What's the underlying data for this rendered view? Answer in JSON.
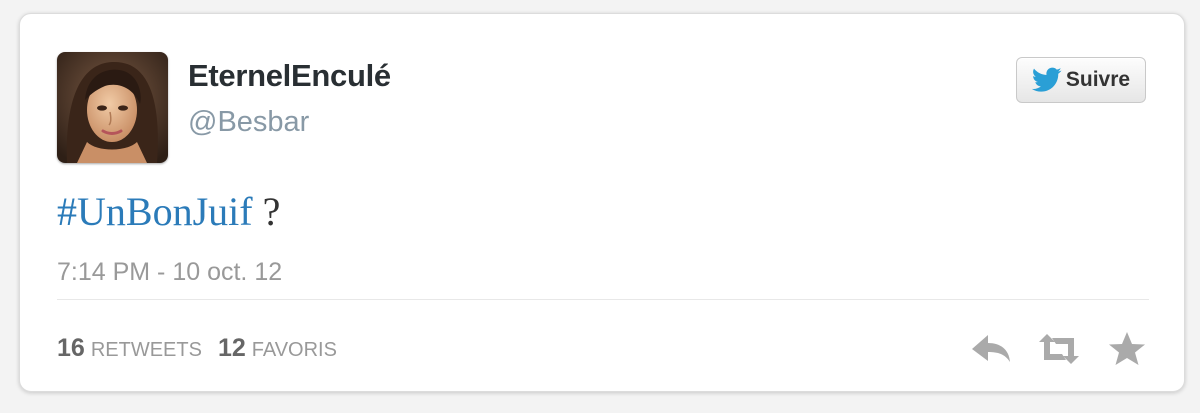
{
  "user": {
    "display_name": "EternelEnculé",
    "screen_name": "@Besbar"
  },
  "follow_button": {
    "label": "Suivre",
    "icon": "twitter-bird-icon"
  },
  "tweet": {
    "hashtag": "#UnBonJuif",
    "text_suffix": " ?",
    "timestamp": "7:14 PM - 10 oct. 12"
  },
  "stats": {
    "retweets_count": "16",
    "retweets_label": "RETWEETS",
    "favorites_count": "12",
    "favorites_label": "FAVORIS"
  },
  "actions": {
    "reply_icon": "reply-icon",
    "retweet_icon": "retweet-icon",
    "favorite_icon": "star-icon"
  },
  "colors": {
    "hashtag": "#2b7bb9",
    "twitter_blue": "#2a9fd6",
    "action_gray": "#aaaaaa"
  }
}
